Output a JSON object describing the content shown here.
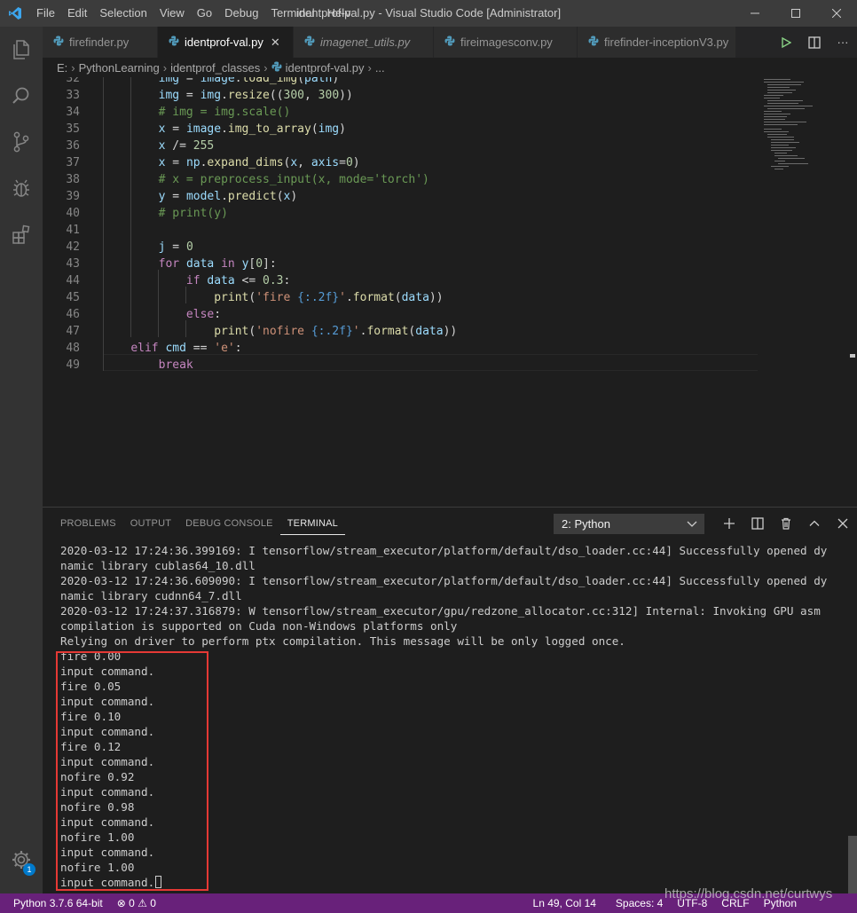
{
  "window": {
    "title": "identprof-val.py - Visual Studio Code [Administrator]",
    "menu": [
      "File",
      "Edit",
      "Selection",
      "View",
      "Go",
      "Debug",
      "Terminal",
      "Help"
    ]
  },
  "tabs": [
    {
      "label": "firefinder.py",
      "active": false,
      "italic": false
    },
    {
      "label": "identprof-val.py",
      "active": true,
      "italic": false
    },
    {
      "label": "imagenet_utils.py",
      "active": false,
      "italic": true
    },
    {
      "label": "fireimagesconv.py",
      "active": false,
      "italic": false
    },
    {
      "label": "firefinder-inceptionV3.py",
      "active": false,
      "italic": false
    }
  ],
  "breadcrumbs": [
    "E:",
    "PythonLearning",
    "identprof_classes",
    "identprof-val.py",
    "..."
  ],
  "editor": {
    "lines": [
      {
        "n": "32",
        "text": "        img = image.load_img(path)"
      },
      {
        "n": "33",
        "text": "        img = img.resize((300, 300))"
      },
      {
        "n": "34",
        "text": "        # img = img.scale()"
      },
      {
        "n": "35",
        "text": "        x = image.img_to_array(img)"
      },
      {
        "n": "36",
        "text": "        x /= 255"
      },
      {
        "n": "37",
        "text": "        x = np.expand_dims(x, axis=0)"
      },
      {
        "n": "38",
        "text": "        # x = preprocess_input(x, mode='torch')"
      },
      {
        "n": "39",
        "text": "        y = model.predict(x)"
      },
      {
        "n": "40",
        "text": "        # print(y)"
      },
      {
        "n": "41",
        "text": ""
      },
      {
        "n": "42",
        "text": "        j = 0"
      },
      {
        "n": "43",
        "text": "        for data in y[0]:"
      },
      {
        "n": "44",
        "text": "            if data <= 0.3:"
      },
      {
        "n": "45",
        "text": "                print('fire {:.2f}'.format(data))"
      },
      {
        "n": "46",
        "text": "            else:"
      },
      {
        "n": "47",
        "text": "                print('nofire {:.2f}'.format(data))"
      },
      {
        "n": "48",
        "text": "    elif cmd == 'e':"
      },
      {
        "n": "49",
        "text": "        break"
      }
    ]
  },
  "panel": {
    "tabs": [
      "PROBLEMS",
      "OUTPUT",
      "DEBUG CONSOLE",
      "TERMINAL"
    ],
    "active_tab": "TERMINAL",
    "terminal_select": "2: Python",
    "terminal_lines": [
      "2020-03-12 17:24:36.399169: I tensorflow/stream_executor/platform/default/dso_loader.cc:44] Successfully opened dy",
      "namic library cublas64_10.dll",
      "2020-03-12 17:24:36.609090: I tensorflow/stream_executor/platform/default/dso_loader.cc:44] Successfully opened dy",
      "namic library cudnn64_7.dll",
      "2020-03-12 17:24:37.316879: W tensorflow/stream_executor/gpu/redzone_allocator.cc:312] Internal: Invoking GPU asm",
      "compilation is supported on Cuda non-Windows platforms only",
      "Relying on driver to perform ptx compilation. This message will be only logged once.",
      "fire 0.00",
      "input command.",
      "fire 0.05",
      "input command.",
      "fire 0.10",
      "input command.",
      "fire 0.12",
      "input command.",
      "nofire 0.92",
      "input command.",
      "nofire 0.98",
      "input command.",
      "nofire 1.00",
      "input command.",
      "nofire 1.00",
      "input command."
    ]
  },
  "activity_badge": "1",
  "statusbar": {
    "python": "Python 3.7.6 64-bit",
    "errors": "0",
    "warnings": "0",
    "position": "Ln 49, Col 14",
    "spaces": "Spaces: 4",
    "encoding": "UTF-8",
    "eol": "CRLF",
    "language": "Python"
  },
  "watermark": "https://blog.csdn.net/curtwys",
  "colors": {
    "statusbar": "#68217a",
    "titlebar": "#3c3c3c",
    "activitybar": "#333333",
    "editor_bg": "#1e1e1e",
    "highlight_box": "#e53935"
  }
}
